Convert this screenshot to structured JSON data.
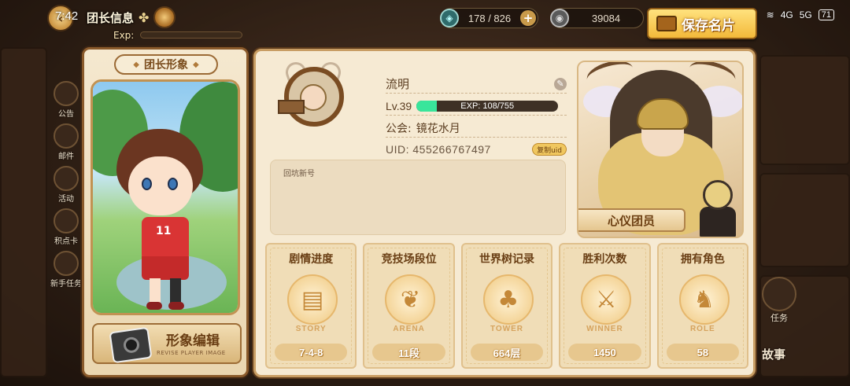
{
  "status_bar": {
    "time": "7:42",
    "network": "4G",
    "signal": "5G",
    "battery": "71"
  },
  "header": {
    "title": "团长信息",
    "exp_label": "Exp:"
  },
  "resources": [
    {
      "icon": "stamina-icon",
      "value": "178 / 826"
    },
    {
      "icon": "gold-coin-icon",
      "value": "39084"
    }
  ],
  "save_card_button": {
    "label": "保存名片"
  },
  "left_menu": {
    "items": [
      {
        "label": "公告"
      },
      {
        "label": "邮件"
      },
      {
        "label": "活动"
      },
      {
        "label": "积点卡"
      },
      {
        "label": "新手任务"
      }
    ]
  },
  "image_panel": {
    "title": "团长形象",
    "jersey_number": "11",
    "edit_button_label": "形象编辑",
    "edit_button_sub": "REVISE PLAYER IMAGE"
  },
  "profile": {
    "name": "流明",
    "level": "Lv.39",
    "exp_text": "EXP: 108/755",
    "exp_current": 108,
    "exp_max": 755,
    "guild_label": "公会:",
    "guild_name": "镜花水月",
    "uid": "UID: 455266767497",
    "copy_uid_label": "复制uid",
    "signature": "回坑新号"
  },
  "leader_card": {
    "label": "心仪团员"
  },
  "stats": [
    {
      "title": "剧情进度",
      "badge": "STORY",
      "value": "7-4-8",
      "icon": "book-icon"
    },
    {
      "title": "竞技场段位",
      "badge": "ARENA",
      "value": "11段",
      "icon": "arena-wings-icon"
    },
    {
      "title": "世界树记录",
      "badge": "TOWER",
      "value": "664层",
      "icon": "tree-icon"
    },
    {
      "title": "胜利次数",
      "badge": "WINNER",
      "value": "1450",
      "icon": "crossed-swords-icon"
    },
    {
      "title": "拥有角色",
      "badge": "ROLE",
      "value": "58",
      "icon": "bunny-icon"
    }
  ],
  "right_side": {
    "task_label": "任务",
    "story_label": "故事"
  },
  "colors": {
    "accent_gold": "#f3b93a",
    "panel_bg": "#f6ead3",
    "exp_green": "#39e59b",
    "title_brown": "#6a3f15"
  }
}
